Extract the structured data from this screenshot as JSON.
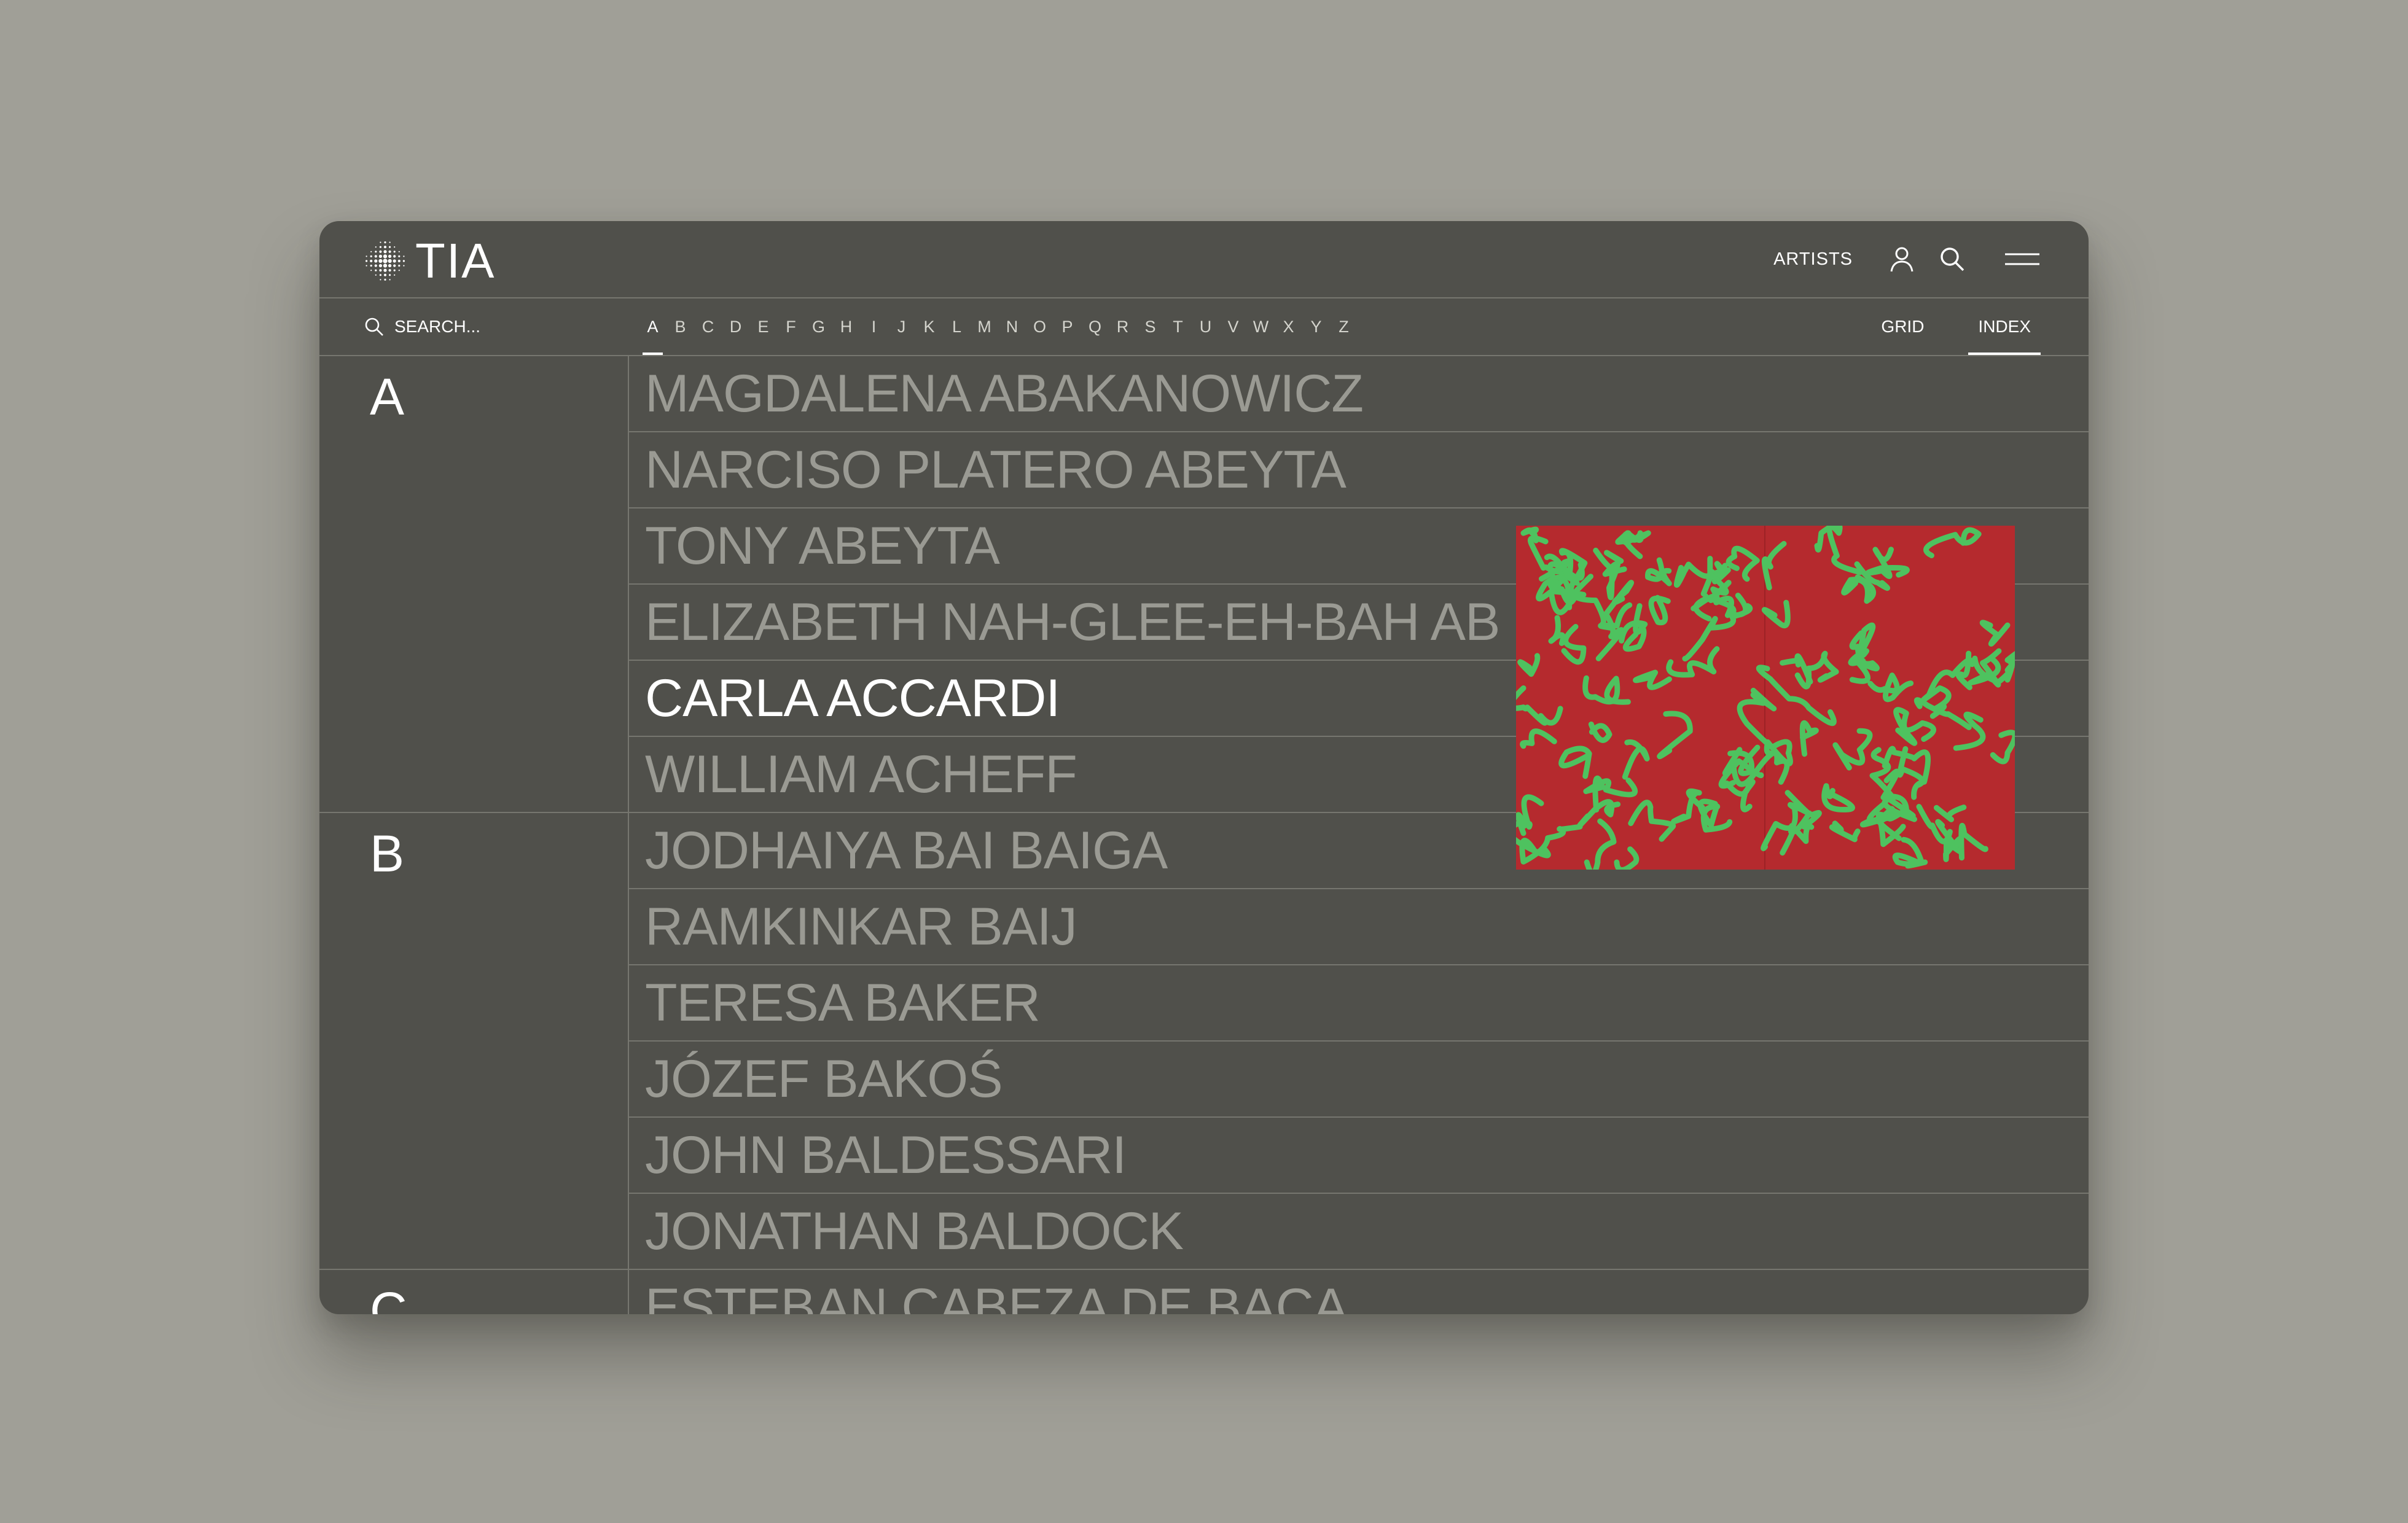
{
  "header": {
    "logo_text": "TIA",
    "nav": {
      "artists_label": "ARTISTS",
      "icons": [
        "user-icon",
        "search-icon",
        "menu-icon"
      ]
    }
  },
  "filter": {
    "search_placeholder": "SEARCH...",
    "alphabet": [
      "A",
      "B",
      "C",
      "D",
      "E",
      "F",
      "G",
      "H",
      "I",
      "J",
      "K",
      "L",
      "M",
      "N",
      "O",
      "P",
      "Q",
      "R",
      "S",
      "T",
      "U",
      "V",
      "W",
      "X",
      "Y",
      "Z"
    ],
    "active_letter": "A",
    "view_options": {
      "grid_label": "GRID",
      "index_label": "INDEX",
      "active": "INDEX"
    }
  },
  "groups": [
    {
      "letter": "A",
      "artists": [
        "MAGDALENA ABAKANOWICZ",
        "NARCISO PLATERO ABEYTA",
        "TONY ABEYTA",
        "ELIZABETH NAH-GLEE-EH-BAH AB",
        "CARLA ACCARDI",
        "WILLIAM ACHEFF"
      ]
    },
    {
      "letter": "B",
      "artists": [
        "JODHAIYA BAI BAIGA",
        "RAMKINKAR BAIJ",
        "TERESA BAKER",
        "JÓZEF BAKOŚ",
        "JOHN BALDESSARI",
        "JONATHAN BALDOCK"
      ]
    },
    {
      "letter": "C",
      "artists": [
        "ESTEBAN CABEZA DE BACA"
      ]
    }
  ],
  "highlighted_artist": "CARLA ACCARDI",
  "preview": {
    "background_color": "#b52a2e",
    "stroke_color": "#4ec25f"
  },
  "colors": {
    "page_background": "#a09f97",
    "window_background": "#50504b",
    "muted_text": "#9a9a93",
    "active_text": "#ffffff"
  }
}
